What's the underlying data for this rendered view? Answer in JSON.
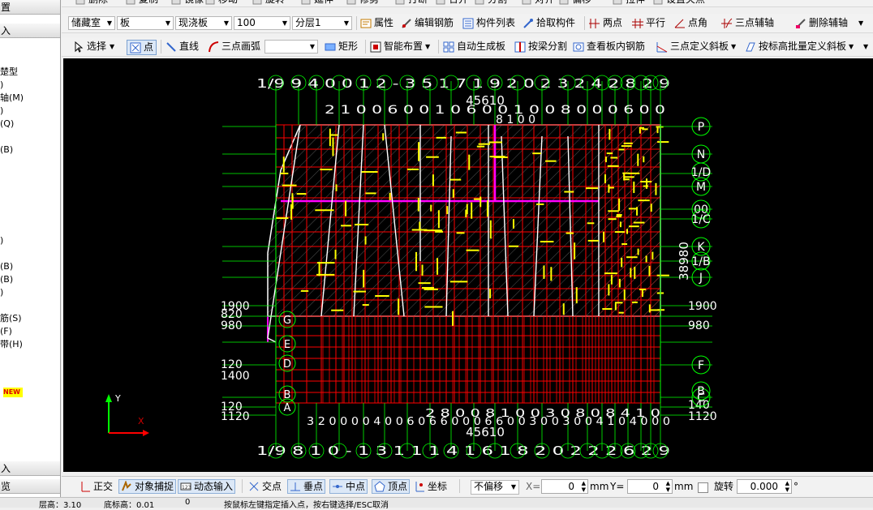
{
  "left_panel": {
    "header_top": "置",
    "header_top2": "入",
    "items": [
      "楚型",
      ")",
      "轴(M)",
      ")",
      "(Q)",
      "",
      "(B)",
      "",
      "",
      "",
      "",
      "",
      "",
      ")",
      "",
      "(B)",
      "(B)",
      ")",
      "筋(S)",
      "(F)",
      "带(H)"
    ],
    "new_badge": "NEW",
    "footer1": "入",
    "footer2": "览"
  },
  "toolbar1": {
    "items": [
      "删除",
      "复制",
      "镜像",
      "移动",
      "旋转",
      "延伸",
      "修剪",
      "打断",
      "合并",
      "分割",
      "对齐",
      "偏移",
      "拉伸",
      "设置夹点"
    ]
  },
  "toolbar2": {
    "floor_category": "储藏室",
    "component_type": "板",
    "component_name": "现浇板",
    "thickness": "100",
    "layer": "分层1",
    "buttons": [
      "属性",
      "编辑钢筋",
      "构件列表",
      "拾取构件",
      "两点",
      "平行",
      "点角",
      "三点辅轴",
      "删除辅轴"
    ]
  },
  "toolbar3": {
    "select_label": "选择",
    "point_label": "点",
    "line_label": "直线",
    "arc_label": "三点画弧",
    "rect_label": "矩形",
    "smart_label": "智能布置",
    "auto_label": "自动生成板",
    "split_label": "按梁分割",
    "view_rebar_label": "查看板内钢筋",
    "slope1_label": "三点定义斜板",
    "slope2_label": "按标高批量定义斜板"
  },
  "canvas": {
    "top_dim": "45610",
    "bottom_dim": "45610",
    "right_dim": "38980",
    "axis_letters_right": [
      "P",
      "N",
      "1/D",
      "M",
      "00",
      "1/C",
      "K",
      "1/B",
      "J",
      "F",
      "C",
      "B"
    ],
    "axis_letters_left": [
      "G",
      "E",
      "D",
      "B",
      "A"
    ],
    "left_dims": [
      "1900",
      "820",
      "980",
      "120",
      "1400",
      "120",
      "1120"
    ],
    "right_low_dims": [
      "1900",
      "980",
      "140",
      "1120"
    ],
    "top_axis_text": "1/9 9 4 0 0 1 2 - 3 5 1 7  1 9 2 0  2 3 2 4 2 8 2 9",
    "top_second_text": "2 1 0 0 6 0 0 1 0 6 0 0 1 0 0 8 0 0 0 6 0 0",
    "top_row3_text": "8 1 0 0",
    "bottom_axis_text": "1/9 8 1 0 - 1 3 1 1  1 4 1 6  1 8 2 0  2 2  2 6 2 9",
    "bottom_dim_text": "3 2 0 0 0 0 4 0 0 6 0 6 6 0 0 0 6 6 0 0 3 0 0 3 0 0 4 1 0 4 0 0 0",
    "bottom_second_text": "2 8 0 0  8 1 0 0  3 0 8 0  8 4 1 0",
    "axis_y_label": "Y",
    "axis_x_label": "X"
  },
  "bottom_bar": {
    "ortho": "正交",
    "snap": "对象捕捉",
    "dynamic": "动态输入",
    "intersect": "交点",
    "perp": "垂点",
    "mid": "中点",
    "vertex": "顶点",
    "coord": "坐标",
    "offset_mode": "不偏移",
    "x_label": "X=",
    "x_value": "0",
    "unit_mm1": "mm",
    "y_label": "Y=",
    "y_value": "0",
    "unit_mm2": "mm",
    "rotate_label": "旋转",
    "rotate_value": "0.000",
    "degree": "°"
  },
  "status_bar": {
    "t1": "层高：3.10",
    "t2": "底标高：0.01",
    "t3": "0",
    "t4": "按鼠标左键指定插入点，按右键选择/ESC取消"
  },
  "colors": {
    "canvas_bg": "#000000",
    "grid_red": "#ff0000",
    "axis_green": "#00ff00",
    "rebar_yellow": "#ffff00",
    "beam_magenta": "#ff00ff",
    "slab_white": "#ffffff"
  }
}
